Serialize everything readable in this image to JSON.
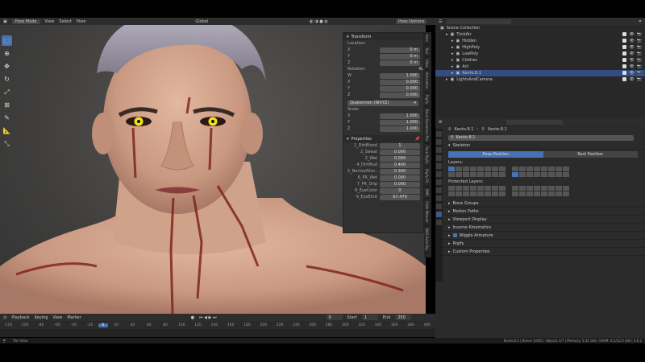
{
  "viewport_header": {
    "mode": "Pose Mode",
    "menus": [
      "View",
      "Select",
      "Pose"
    ],
    "orientation": "Global",
    "pose_options": "Pose Options"
  },
  "npanel": {
    "transform_title": "Transform",
    "location_label": "Location:",
    "location": [
      {
        "axis": "X",
        "value": "0 m"
      },
      {
        "axis": "Y",
        "value": "0 m"
      },
      {
        "axis": "Z",
        "value": "0 m"
      }
    ],
    "rotation_label": "Rotation:",
    "rotation_mode_tag": "4L",
    "rotation": [
      {
        "axis": "W",
        "value": "1.000"
      },
      {
        "axis": "X",
        "value": "0.000"
      },
      {
        "axis": "Y",
        "value": "0.000"
      },
      {
        "axis": "Z",
        "value": "0.000"
      }
    ],
    "rotation_mode": "Quaternion (WXYZ)",
    "scale_label": "Scale:",
    "scale": [
      {
        "axis": "X",
        "value": "1.000"
      },
      {
        "axis": "Y",
        "value": "1.000"
      },
      {
        "axis": "Z",
        "value": "1.000"
      }
    ],
    "properties_title": "Properties",
    "properties": [
      {
        "name": "1_DirtBlood",
        "value": "1"
      },
      {
        "name": "2_Sweat",
        "value": "0.000"
      },
      {
        "name": "3_Wet",
        "value": "0.000"
      },
      {
        "name": "4_DirtMud",
        "value": "0.400"
      },
      {
        "name": "5_NormalStre...",
        "value": "0.300"
      },
      {
        "name": "6_PR_Wet",
        "value": "0.000"
      },
      {
        "name": "7_PR_Drip",
        "value": "0.000"
      },
      {
        "name": "8_EyeColor",
        "value": "0"
      },
      {
        "name": "9_EyeEmit",
        "value": "67.470"
      }
    ]
  },
  "side_tabs": [
    "Item",
    "Tool",
    "View",
    "Animation",
    "Rigify",
    "Bone Dynamics Pro",
    "Face Rigify",
    "Rigify Fit",
    "KM5",
    "Cloth Weaver",
    "BAD Auto Rig"
  ],
  "outliner": {
    "title": "Scene Collection",
    "rows": [
      {
        "label": "TrickAir",
        "indent": 1,
        "selected": false
      },
      {
        "label": "Hidden",
        "indent": 2,
        "selected": false
      },
      {
        "label": "HighPoly",
        "indent": 2,
        "selected": false
      },
      {
        "label": "LowPoly",
        "indent": 2,
        "selected": false
      },
      {
        "label": "Clothes",
        "indent": 2,
        "selected": false
      },
      {
        "label": "Act",
        "indent": 2,
        "selected": false
      },
      {
        "label": "Kento.8.1",
        "indent": 2,
        "selected": true
      },
      {
        "label": "LightsAndCamera",
        "indent": 1,
        "selected": false
      }
    ]
  },
  "properties_editor": {
    "breadcrumb_obj": "Kento.8.1",
    "breadcrumb_arm": "Kento.8.1",
    "armature_name": "Kento.8.1",
    "skeleton_title": "Skeleton",
    "pose_position": "Pose Position",
    "rest_position": "Rest Position",
    "layers_label": "Layers:",
    "protected_layers_label": "Protected Layers:",
    "sections": [
      "Bone Groups",
      "Motion Paths",
      "Viewport Display",
      "Inverse Kinematics",
      "Wiggle Armature",
      "Rigify",
      "Custom Properties"
    ]
  },
  "timeline": {
    "menus": [
      "Playback",
      "Keying",
      "View",
      "Marker"
    ],
    "current_frame": "0",
    "start_label": "Start",
    "start": "1",
    "end_label": "End",
    "end": "250",
    "ruler": [
      "-110",
      "-100",
      "-80",
      "-60",
      "-40",
      "-20",
      "0",
      "20",
      "40",
      "60",
      "80",
      "100",
      "120",
      "140",
      "160",
      "180",
      "200",
      "220",
      "240",
      "260",
      "280",
      "300",
      "320",
      "340",
      "360",
      "380",
      "400"
    ]
  },
  "statusbar": {
    "hint": "Pan View",
    "stats": "Kento.8.1 | Bones 1/005 | Objects 1/7 | Memory: 5.41 GiB | VRAM: 4.5/12.0 GiB | 3.6.2"
  },
  "colors": {
    "accent": "#4772b3",
    "panel_bg": "#303030",
    "eye": "#f2e21a"
  }
}
